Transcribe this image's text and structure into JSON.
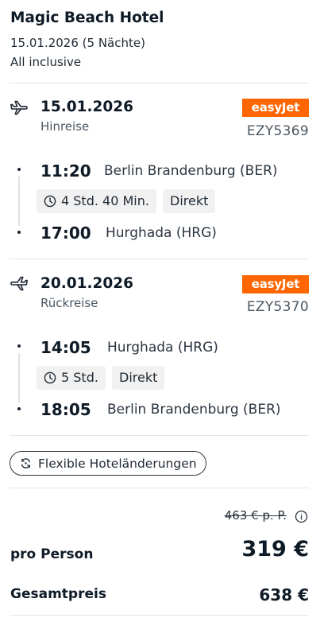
{
  "hotel": {
    "name": "Magic Beach Hotel",
    "dates": "15.01.2026 (5 Nächte)",
    "board": "All inclusive"
  },
  "outbound": {
    "date": "15.01.2026",
    "label": "Hinreise",
    "airline": "easyJet",
    "flight_number": "EZY5369",
    "departure_time": "11:20",
    "departure_airport": "Berlin Brandenburg (BER)",
    "duration": "4 Std. 40 Min.",
    "stops": "Direkt",
    "arrival_time": "17:00",
    "arrival_airport": "Hurghada (HRG)",
    "icon": "plane-takeoff-icon"
  },
  "return": {
    "date": "20.01.2026",
    "label": "Rückreise",
    "airline": "easyJet",
    "flight_number": "EZY5370",
    "departure_time": "14:05",
    "departure_airport": "Hurghada (HRG)",
    "duration": "5 Std.",
    "stops": "Direkt",
    "arrival_time": "18:05",
    "arrival_airport": "Berlin Brandenburg (BER)",
    "icon": "plane-landing-icon"
  },
  "flex_button": {
    "label": "Flexible Hoteländerungen",
    "icon": "refresh-icon"
  },
  "pricing": {
    "old_price": "463 € p. P.",
    "per_person_label": "pro Person",
    "per_person_price": "319 €",
    "total_label": "Gesamtpreis",
    "total_price": "638 €",
    "info_icon": "info-icon"
  },
  "colors": {
    "airline_brand": "#ff6600",
    "text_primary": "#0e1a26",
    "divider": "#e4e6e9",
    "chip_bg": "#f1f1f1"
  }
}
